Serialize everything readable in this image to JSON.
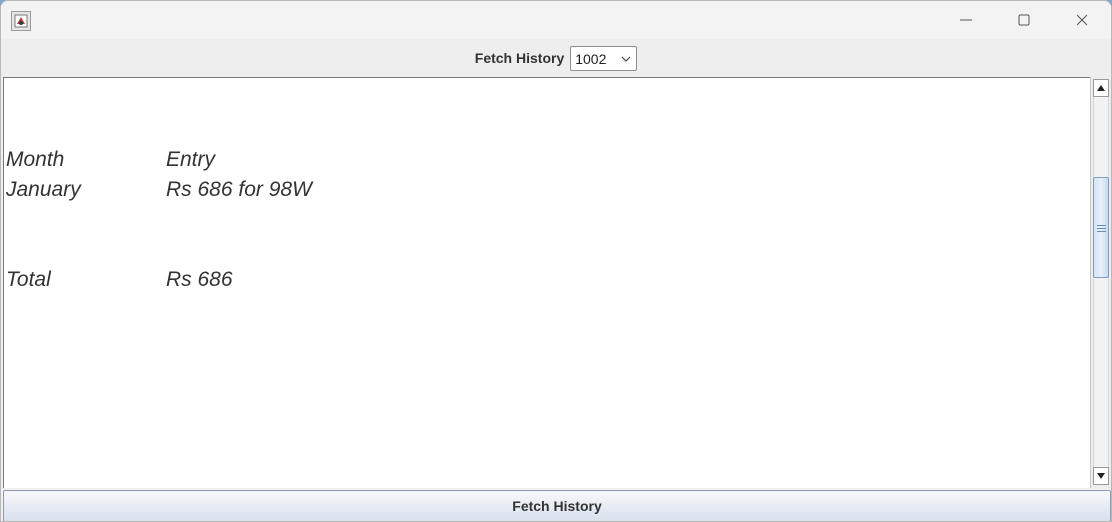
{
  "window": {
    "icon": "java-app-icon",
    "controls": [
      "minimize-icon",
      "maximize-icon",
      "close-icon"
    ]
  },
  "toolbar": {
    "label": "Fetch History",
    "selected_id": "1002"
  },
  "history": {
    "rows": [
      {
        "month": "Month",
        "entry": "Entry"
      },
      {
        "month": "January",
        "entry": "Rs 686 for 98W"
      },
      {
        "month": "Total",
        "entry": "Rs 686"
      }
    ]
  },
  "footer": {
    "button_label": "Fetch History"
  }
}
